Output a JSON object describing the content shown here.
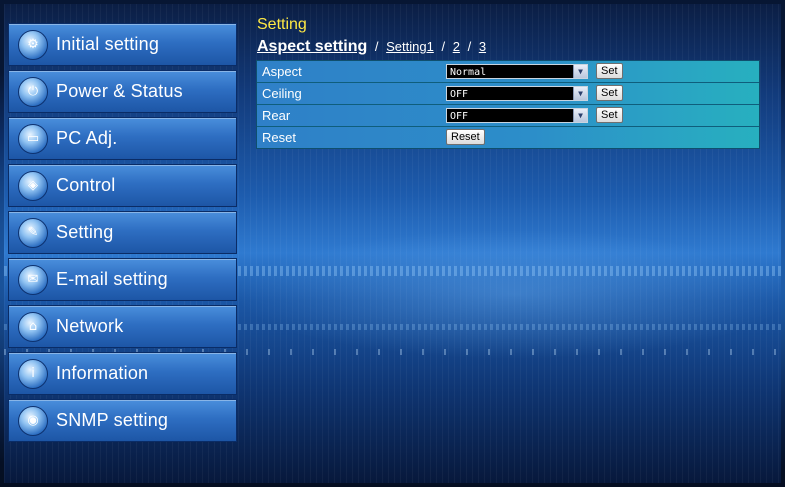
{
  "sidebar": {
    "items": [
      {
        "label": "Initial setting",
        "icon": "gear-icon",
        "glyph": "⚙"
      },
      {
        "label": "Power & Status",
        "icon": "power-icon",
        "glyph": "⏻"
      },
      {
        "label": "PC Adj.",
        "icon": "monitor-icon",
        "glyph": "▭"
      },
      {
        "label": "Control",
        "icon": "control-icon",
        "glyph": "◈"
      },
      {
        "label": "Setting",
        "icon": "wrench-icon",
        "glyph": "✎"
      },
      {
        "label": "E-mail setting",
        "icon": "mail-icon",
        "glyph": "✉"
      },
      {
        "label": "Network",
        "icon": "network-icon",
        "glyph": "⌂"
      },
      {
        "label": "Information",
        "icon": "info-icon",
        "glyph": "i"
      },
      {
        "label": "SNMP setting",
        "icon": "snmp-icon",
        "glyph": "◉"
      }
    ]
  },
  "main": {
    "title": "Setting",
    "breadcrumb": {
      "current": "Aspect setting",
      "sep1": "/",
      "link1": "Setting1",
      "sep2": "/",
      "link2": "2",
      "sep3": "/",
      "link3": "3"
    },
    "rows": [
      {
        "label": "Aspect",
        "value": "Normal",
        "button": "Set"
      },
      {
        "label": "Ceiling",
        "value": "OFF",
        "button": "Set"
      },
      {
        "label": "Rear",
        "value": "OFF",
        "button": "Set"
      },
      {
        "label": "Reset",
        "button": "Reset"
      }
    ]
  },
  "colors": {
    "title": "#ffe944",
    "sidebar_item": "#2e6ec2",
    "table_row": "#2c8ec9"
  }
}
